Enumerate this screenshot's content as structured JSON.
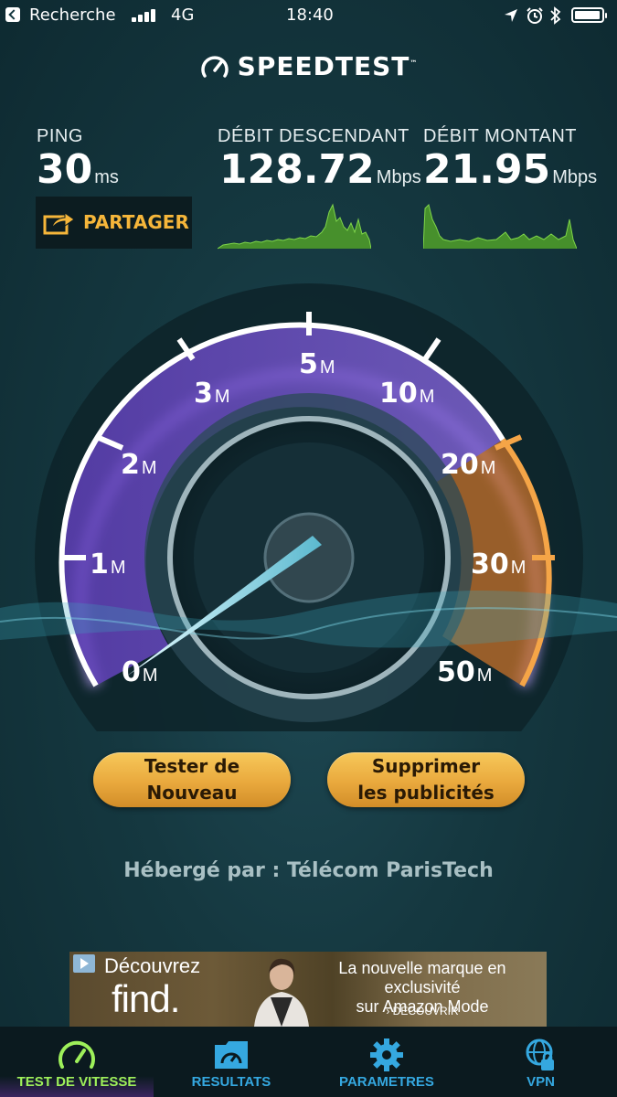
{
  "status_bar": {
    "back_label": "Recherche",
    "network": "4G",
    "time": "18:40",
    "battery_level": 0.95
  },
  "app": {
    "title": "SPEEDTEST",
    "trademark": "™"
  },
  "metrics": {
    "ping": {
      "label": "PING",
      "value": "30",
      "unit": "ms"
    },
    "download": {
      "label": "DÉBIT DESCENDANT",
      "value": "128.72",
      "unit": "Mbps"
    },
    "upload": {
      "label": "DÉBIT MONTANT",
      "value": "21.95",
      "unit": "Mbps"
    }
  },
  "share": {
    "label": "PARTAGER"
  },
  "gauge": {
    "ticks": [
      {
        "value": "0",
        "unit": "M"
      },
      {
        "value": "1",
        "unit": "M"
      },
      {
        "value": "2",
        "unit": "M"
      },
      {
        "value": "3",
        "unit": "M"
      },
      {
        "value": "5",
        "unit": "M"
      },
      {
        "value": "10",
        "unit": "M"
      },
      {
        "value": "20",
        "unit": "M"
      },
      {
        "value": "30",
        "unit": "M"
      },
      {
        "value": "50",
        "unit": "M"
      }
    ]
  },
  "buttons": {
    "retest_line1": "Tester de",
    "retest_line2": "Nouveau",
    "remove_ads_line1": "Supprimer",
    "remove_ads_line2": "les publicités"
  },
  "hosted_by": "Hébergé par : Télécom ParisTech",
  "ad": {
    "headline": "Découvrez",
    "brand": "find.",
    "tagline_line1": "La nouvelle marque en exclusivité",
    "tagline_line2": "sur Amazon Mode",
    "cta": "› DÉCOUVRIR"
  },
  "tabs": [
    {
      "label": "TEST DE VITESSE",
      "icon": "speedometer-icon",
      "active": true
    },
    {
      "label": "RESULTATS",
      "icon": "results-folder-icon",
      "active": false
    },
    {
      "label": "PARAMETRES",
      "icon": "gear-icon",
      "active": false
    },
    {
      "label": "VPN",
      "icon": "globe-lock-icon",
      "active": false
    }
  ],
  "colors": {
    "accent_gold": "#f6b63a",
    "tab_active": "#9ef05a",
    "tab_inactive": "#35a8e0",
    "gauge_purple": "#7b55d8",
    "gauge_orange": "#f08a28",
    "download_spark": "#6ec23a"
  }
}
